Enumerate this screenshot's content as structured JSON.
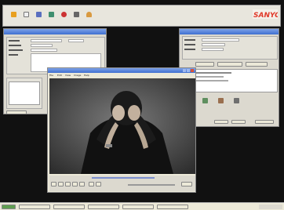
{
  "brand": {
    "name": "SANYO",
    "color": "#e03a2a"
  },
  "toolbar": {
    "items": [
      {
        "icon": "folder-icon"
      },
      {
        "icon": "document-icon"
      },
      {
        "icon": "camera-icon"
      },
      {
        "icon": "monitor-icon"
      },
      {
        "icon": "record-icon"
      },
      {
        "icon": "film-icon"
      },
      {
        "icon": "person-icon"
      }
    ]
  },
  "viewer": {
    "menu": [
      "File",
      "Edit",
      "View",
      "Image",
      "Help"
    ]
  },
  "colors": {
    "background": "#111111",
    "window": "#dcd9cf",
    "titlebar": "#3f6fd0",
    "taskbar": "#ece9d8",
    "photo": "#4a4a4a"
  }
}
